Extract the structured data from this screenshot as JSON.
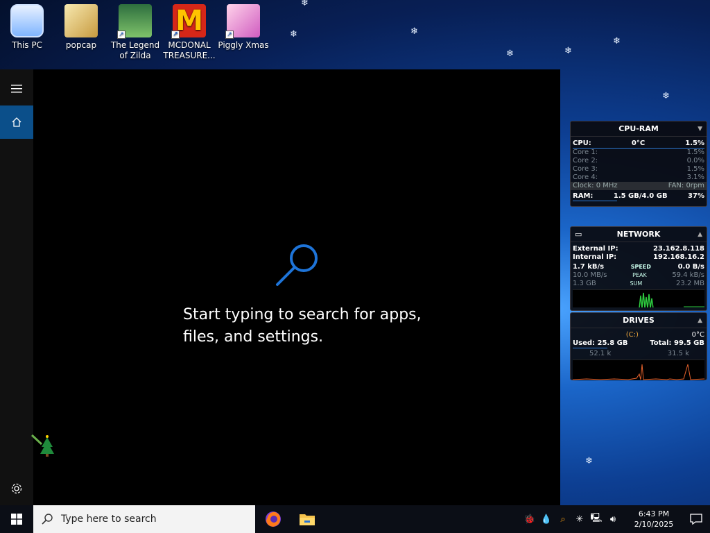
{
  "desktop": {
    "icons": [
      {
        "label": "This PC",
        "icon": "this-pc-icon"
      },
      {
        "label": "popcap",
        "icon": "folder-icon"
      },
      {
        "label": "The Legend of Zilda",
        "icon": "game-shortcut-icon"
      },
      {
        "label": "MCDONAL TREASURE...",
        "icon": "mcdonalds-shortcut-icon"
      },
      {
        "label": "Piggly Xmas",
        "icon": "piggy-shortcut-icon"
      }
    ]
  },
  "start": {
    "search_hint": "Start typing to search for apps, files, and settings."
  },
  "cpu_ram": {
    "title": "CPU-RAM",
    "cpu_label": "CPU:",
    "cpu_temp": "0°C",
    "cpu_value": "1.5%",
    "cores": [
      {
        "label": "Core 1:",
        "value": "1.5%"
      },
      {
        "label": "Core 2:",
        "value": "0.0%"
      },
      {
        "label": "Core 3:",
        "value": "1.5%"
      },
      {
        "label": "Core 4:",
        "value": "3.1%"
      }
    ],
    "clock_label": "Clock: 0 MHz",
    "fan_label": "FAN: 0rpm",
    "ram_label": "RAM:",
    "ram_value": "1.5 GB/4.0 GB",
    "ram_percent": "37%"
  },
  "network": {
    "title": "NETWORK",
    "external_label": "External IP:",
    "external_ip": "23.162.8.118",
    "internal_label": "Internal IP:",
    "internal_ip": "192.168.16.2",
    "rows": [
      {
        "left": "1.7 kB/s",
        "mid": "SPEED",
        "right": "0.0 B/s"
      },
      {
        "left": "10.0 MB/s",
        "mid": "PEAK",
        "right": "59.4 kB/s"
      },
      {
        "left": "1.3 GB",
        "mid": "SUM",
        "right": "23.2 MB"
      }
    ]
  },
  "drives": {
    "title": "DRIVES",
    "drive": "(C:)",
    "temp": "0°C",
    "used": "Used: 25.8 GB",
    "total": "Total: 99.5 GB",
    "read": "52.1 k",
    "write": "31.5 k"
  },
  "taskbar": {
    "search_placeholder": "Type here to search",
    "time": "6:43 PM",
    "date": "2/10/2025"
  },
  "colors": {
    "accent": "#0b4f8a",
    "gadget_bar": "#2e7bd6"
  }
}
